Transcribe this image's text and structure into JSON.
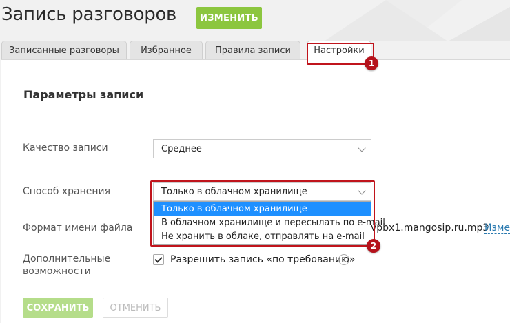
{
  "header": {
    "title": "Запись разговоров",
    "edit_label": "ИЗМЕНИТЬ"
  },
  "tabs": [
    {
      "label": "Записанные разговоры"
    },
    {
      "label": "Избранное"
    },
    {
      "label": "Правила записи"
    },
    {
      "label": "Настройки",
      "active": true
    }
  ],
  "annotations": {
    "badge1": "1",
    "badge2": "2",
    "color": "#c0141c"
  },
  "section": {
    "title": "Параметры записи"
  },
  "quality": {
    "label": "Качество записи",
    "value": "Среднее"
  },
  "storage": {
    "label": "Способ хранения",
    "value": "Только в облачном хранилище",
    "options": [
      "Только в облачном хранилище",
      "В облачном хранилище и пересылать по e-mail",
      "Не хранить в облаке, отправлять на e-mail"
    ],
    "selected_index": 0
  },
  "filename": {
    "label": "Формат имени файла",
    "value": "vpbx1.mangosip.ru.mp3",
    "change_label": "Изменить"
  },
  "extras": {
    "label_line1": "Дополнительные",
    "label_line2": "возможности",
    "checkbox_label": "Разрешить запись «по требованию»",
    "checked": true,
    "help_icon": "?"
  },
  "footer": {
    "save_label": "СОХРАНИТЬ",
    "cancel_label": "ОТМЕНИТЬ"
  },
  "colors": {
    "accent": "#8cc63f",
    "selection": "#1e90ff",
    "link": "#2a7ab0"
  }
}
